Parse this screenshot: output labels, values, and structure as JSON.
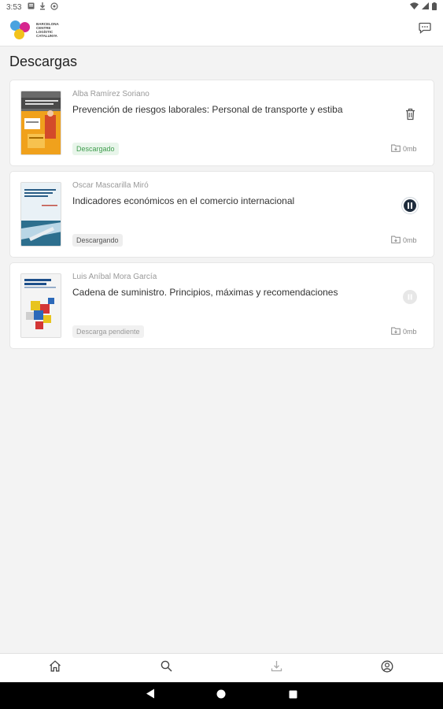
{
  "status_bar": {
    "time": "3:53"
  },
  "app": {
    "logo_text": "Barcelona Centre Logístic Catalunya",
    "chat_icon": "chat-icon"
  },
  "page": {
    "title": "Descargas"
  },
  "downloads": [
    {
      "author": "Alba Ramírez Soriano",
      "title": "Prevención de riesgos laborales: Personal de transporte y estiba",
      "status": "Descargado",
      "status_type": "done",
      "size": "0mb",
      "action_icon": "trash-icon"
    },
    {
      "author": "Oscar Mascarilla Miró",
      "title": "Indicadores económicos en el comercio internacional",
      "status": "Descargando",
      "status_type": "progress",
      "size": "0mb",
      "action_icon": "pause-icon"
    },
    {
      "author": "Luis Aníbal Mora García",
      "title": "Cadena de suministro. Principios, máximas y recomendaciones",
      "status": "Descarga pendiente",
      "status_type": "pending",
      "size": "0mb",
      "action_icon": "pending-icon"
    }
  ],
  "bottom_nav": [
    "home-icon",
    "search-icon",
    "downloads-icon",
    "profile-icon"
  ],
  "colors": {
    "accent_green": "#3f9d4e",
    "pause_bg": "#1f2d3d",
    "logo_blue": "#4aa3df",
    "logo_magenta": "#d6268e",
    "logo_yellow": "#f2c21b"
  }
}
